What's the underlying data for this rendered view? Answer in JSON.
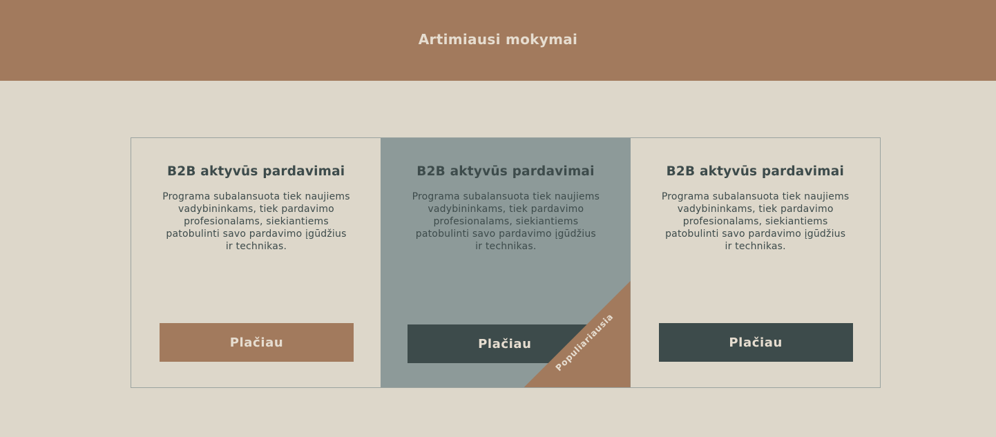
{
  "header": {
    "title": "Artimiausi mokymai"
  },
  "cards": [
    {
      "title": "B2B aktyvūs pardavimai",
      "description": "Programa subalansuota tiek naujiems vadybininkams, tiek pardavimo profesionalams, siekiantiems patobulinti savo pardavimo įgūdžius ir technikas.",
      "button_label": "Plačiau"
    },
    {
      "title": "B2B aktyvūs pardavimai",
      "description": "Programa subalansuota tiek naujiems vadybininkams, tiek pardavimo profesionalams, siekiantiems patobulinti savo pardavimo įgūdžius ir technikas.",
      "button_label": "Plačiau",
      "badge": "Populiariausia"
    },
    {
      "title": "B2B aktyvūs pardavimai",
      "description": "Programa subalansuota tiek naujiems vadybininkams, tiek pardavimo profesionalams, siekiantiems patobulinti savo pardavimo įgūdžius ir technikas.",
      "button_label": "Plačiau"
    }
  ],
  "colors": {
    "background": "#ddd7ca",
    "brand": "#a27a5d",
    "dark": "#3d4b4b",
    "featured": "#8d9a99"
  }
}
